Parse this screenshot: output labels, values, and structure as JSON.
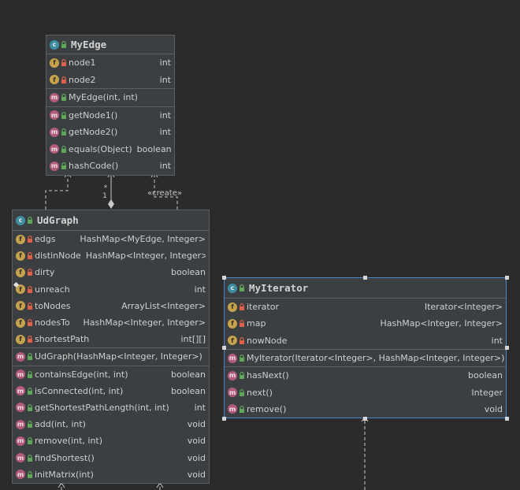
{
  "classes": {
    "myedge": {
      "name": "MyEdge",
      "fields": [
        {
          "name": "node1",
          "type": "int"
        },
        {
          "name": "node2",
          "type": "int"
        }
      ],
      "constructors": [
        {
          "name": "MyEdge(int, int)",
          "type": ""
        }
      ],
      "methods": [
        {
          "name": "getNode1()",
          "type": "int"
        },
        {
          "name": "getNode2()",
          "type": "int"
        },
        {
          "name": "equals(Object)",
          "type": "boolean"
        },
        {
          "name": "hashCode()",
          "type": "int"
        }
      ]
    },
    "udgraph": {
      "name": "UdGraph",
      "fields": [
        {
          "name": "edgs",
          "type": "HashMap<MyEdge, Integer>"
        },
        {
          "name": "distinNode",
          "type": "HashMap<Integer, Integer>"
        },
        {
          "name": "dirty",
          "type": "boolean"
        },
        {
          "name": "unreach",
          "type": "int"
        },
        {
          "name": "toNodes",
          "type": "ArrayList<Integer>"
        },
        {
          "name": "nodesTo",
          "type": "HashMap<Integer, Integer>"
        },
        {
          "name": "shortestPath",
          "type": "int[][]"
        }
      ],
      "constructors": [
        {
          "name": "UdGraph(HashMap<Integer, Integer>)",
          "type": ""
        }
      ],
      "methods": [
        {
          "name": "containsEdge(int, int)",
          "type": "boolean"
        },
        {
          "name": "isConnected(int, int)",
          "type": "boolean"
        },
        {
          "name": "getShortestPathLength(int, int)",
          "type": "int"
        },
        {
          "name": "add(int, int)",
          "type": "void"
        },
        {
          "name": "remove(int, int)",
          "type": "void"
        },
        {
          "name": "findShortest()",
          "type": "void"
        },
        {
          "name": "initMatrix(int)",
          "type": "void"
        }
      ]
    },
    "myiterator": {
      "name": "MyIterator",
      "fields": [
        {
          "name": "iterator",
          "type": "Iterator<Integer>"
        },
        {
          "name": "map",
          "type": "HashMap<Integer, Integer>"
        },
        {
          "name": "nowNode",
          "type": "int"
        }
      ],
      "constructors": [
        {
          "name": "MyIterator(Iterator<Integer>, HashMap<Integer, Integer>)",
          "type": ""
        }
      ],
      "methods": [
        {
          "name": "hasNext()",
          "type": "boolean"
        },
        {
          "name": "next()",
          "type": "Integer"
        },
        {
          "name": "remove()",
          "type": "void"
        }
      ]
    }
  },
  "links": {
    "multiplicity_many": "*",
    "multiplicity_one": "1",
    "create_label": "«create»"
  },
  "colors": {
    "background": "#2b2b2b",
    "class_fill": "#3b3f41",
    "border": "#5c5f61",
    "selection_border": "#4a88c7",
    "class_badge": "#3d8ea3",
    "field_badge": "#c7a24c",
    "method_badge": "#b25b7b",
    "private_lock": "#e0604a",
    "public_lock": "#5fa85a",
    "link_line": "#c8c8c8"
  }
}
